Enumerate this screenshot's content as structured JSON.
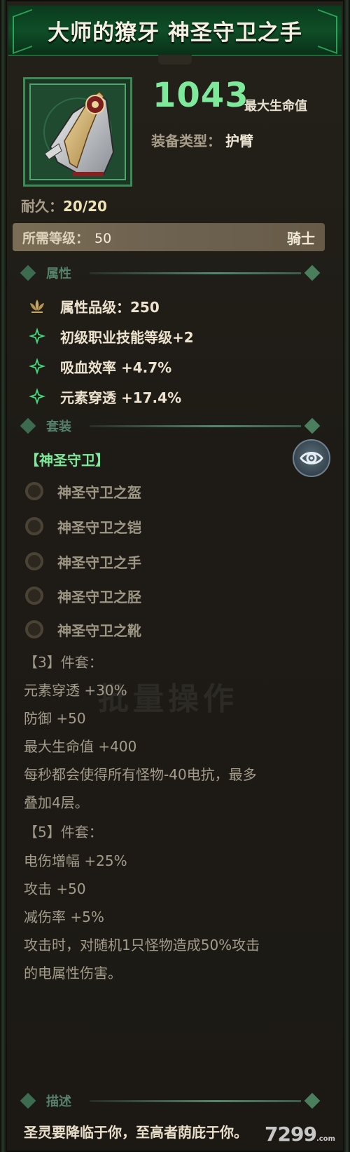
{
  "item": {
    "title": "大师的獠牙 神圣守卫之手",
    "stat_value": "1043",
    "stat_label": "最大生命值",
    "equip_type_label": "装备类型：",
    "equip_type_value": "护臂",
    "durability_label": "耐久：",
    "durability_value": "20/20",
    "required_level_label": "所需等级：",
    "required_level_value": "50",
    "class": "骑士"
  },
  "attributes": {
    "section_label": "属性",
    "rows": [
      {
        "icon": "lotus-icon",
        "text": "属性品级：250"
      },
      {
        "icon": "sparkle-icon",
        "text": "初级职业技能等级+2"
      },
      {
        "icon": "sparkle-icon",
        "text": "吸血效率 +4.7%"
      },
      {
        "icon": "sparkle-icon",
        "text": "元素穿透 +17.4%"
      }
    ]
  },
  "set": {
    "section_label": "套装",
    "name": "【神圣守卫】",
    "items": [
      "神圣守卫之盔",
      "神圣守卫之铠",
      "神圣守卫之手",
      "神圣守卫之胫",
      "神圣守卫之靴"
    ],
    "bonus_lines": [
      "【3】件套：",
      "元素穿透 +30%",
      "防御 +50",
      "最大生命值 +400",
      "每秒都会使得所有怪物-40电抗，最多",
      "叠加4层。",
      "【5】件套：",
      "电伤增幅 +25%",
      "攻击 +50",
      "减伤率 +5%",
      "攻击时，对随机1只怪物造成50%攻击",
      "的电属性伤害。"
    ]
  },
  "description": {
    "section_label": "描述",
    "text": "圣灵要降临于你，至高者荫庇于你。"
  },
  "background_watermark": "批量操作",
  "logo_text": "7299",
  "logo_suffix": ".com",
  "colors": {
    "accent_green": "#7ee99a",
    "title_bg": "#0e4e27",
    "panel_bg": "#1e1b16"
  }
}
